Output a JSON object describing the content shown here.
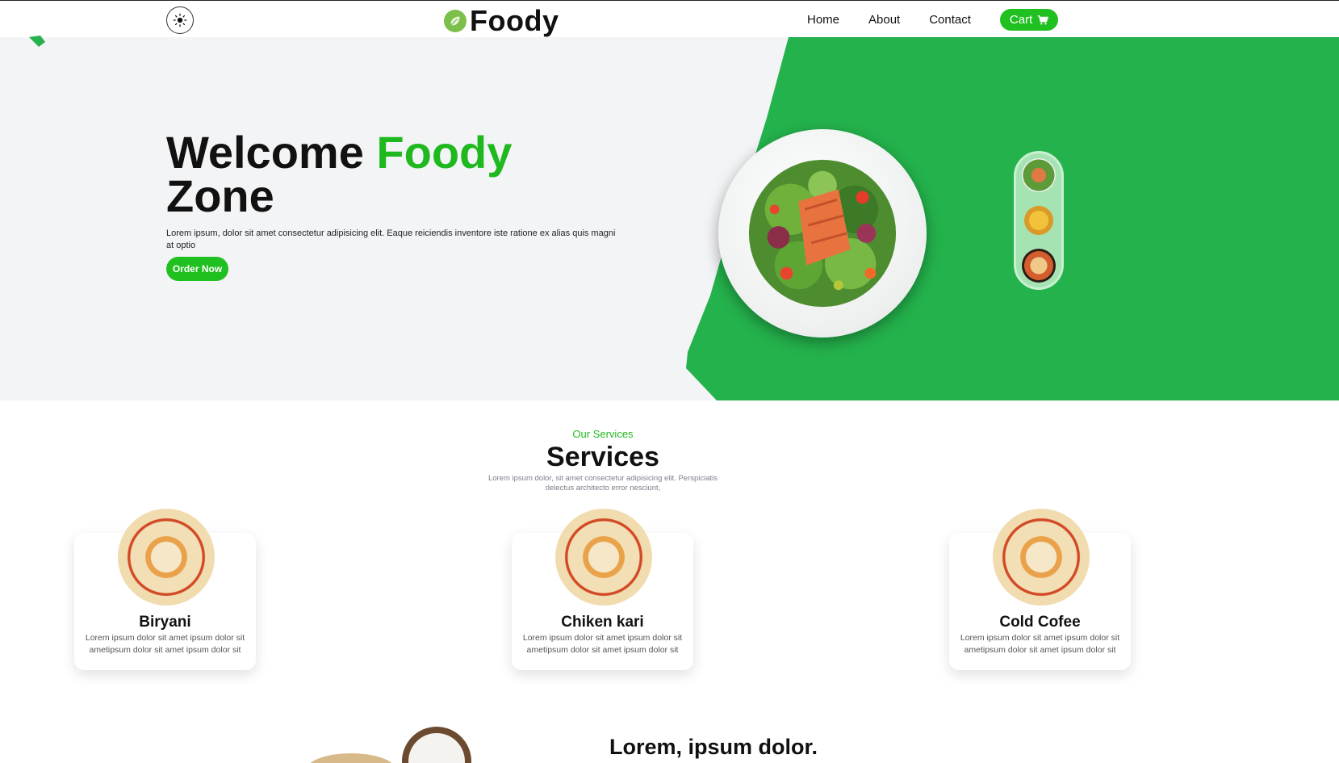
{
  "header": {
    "brand": "Foody",
    "nav": [
      "Home",
      "About",
      "Contact"
    ],
    "cart_label": "Cart"
  },
  "hero": {
    "title_part1": "Welcome ",
    "title_accent": "Foody",
    "title_part2": "Zone",
    "description": "Lorem ipsum, dolor sit amet consectetur adipisicing elit. Eaque reiciendis inventore iste ratione ex alias quis magni at optio",
    "order_button": "Order Now"
  },
  "services": {
    "subtitle": "Our Services",
    "title": "Services",
    "description": "Lorem ipsum dolor, sit amet consectetur adipisicing elit. Perspiciatis delectus architecto error nesciunt,",
    "cards": [
      {
        "title": "Biryani",
        "text": "Lorem ipsum dolor sit amet ipsum dolor sit ametipsum dolor sit amet ipsum dolor sit"
      },
      {
        "title": "Chiken kari",
        "text": "Lorem ipsum dolor sit amet ipsum dolor sit ametipsum dolor sit amet ipsum dolor sit"
      },
      {
        "title": "Cold Cofee",
        "text": "Lorem ipsum dolor sit amet ipsum dolor sit ametipsum dolor sit amet ipsum dolor sit"
      }
    ]
  },
  "about": {
    "title": "Lorem, ipsum dolor."
  },
  "colors": {
    "accent": "#1fc01f",
    "hero_green": "#24b24c",
    "hero_bg": "#f3f4f6"
  }
}
